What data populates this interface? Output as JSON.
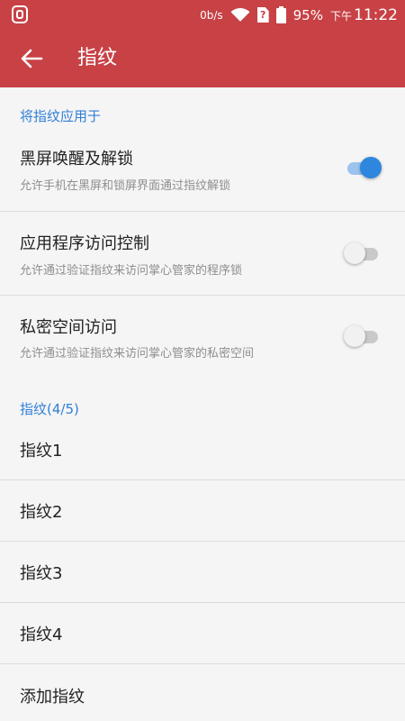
{
  "status_bar": {
    "net_speed": "0b/s",
    "battery_percent": "95%",
    "time_prefix": "下午",
    "time": "11:22",
    "sim_label": "?"
  },
  "app_bar": {
    "title": "指纹"
  },
  "section_apply": {
    "header": "将指纹应用于",
    "items": [
      {
        "title": "黑屏唤醒及解锁",
        "subtitle": "允许手机在黑屏和锁屏界面通过指纹解锁",
        "enabled": true
      },
      {
        "title": "应用程序访问控制",
        "subtitle": "允许通过验证指纹来访问掌心管家的程序锁",
        "enabled": false
      },
      {
        "title": "私密空间访问",
        "subtitle": "允许通过验证指纹来访问掌心管家的私密空间",
        "enabled": false
      }
    ]
  },
  "section_fingerprints": {
    "header": "指纹(4/5)",
    "items": [
      "指纹1",
      "指纹2",
      "指纹3",
      "指纹4"
    ],
    "add_label": "添加指纹"
  },
  "colors": {
    "app_bar": "#c74145",
    "accent_blue": "#2f7fd6",
    "switch_on": "#2f86de"
  }
}
